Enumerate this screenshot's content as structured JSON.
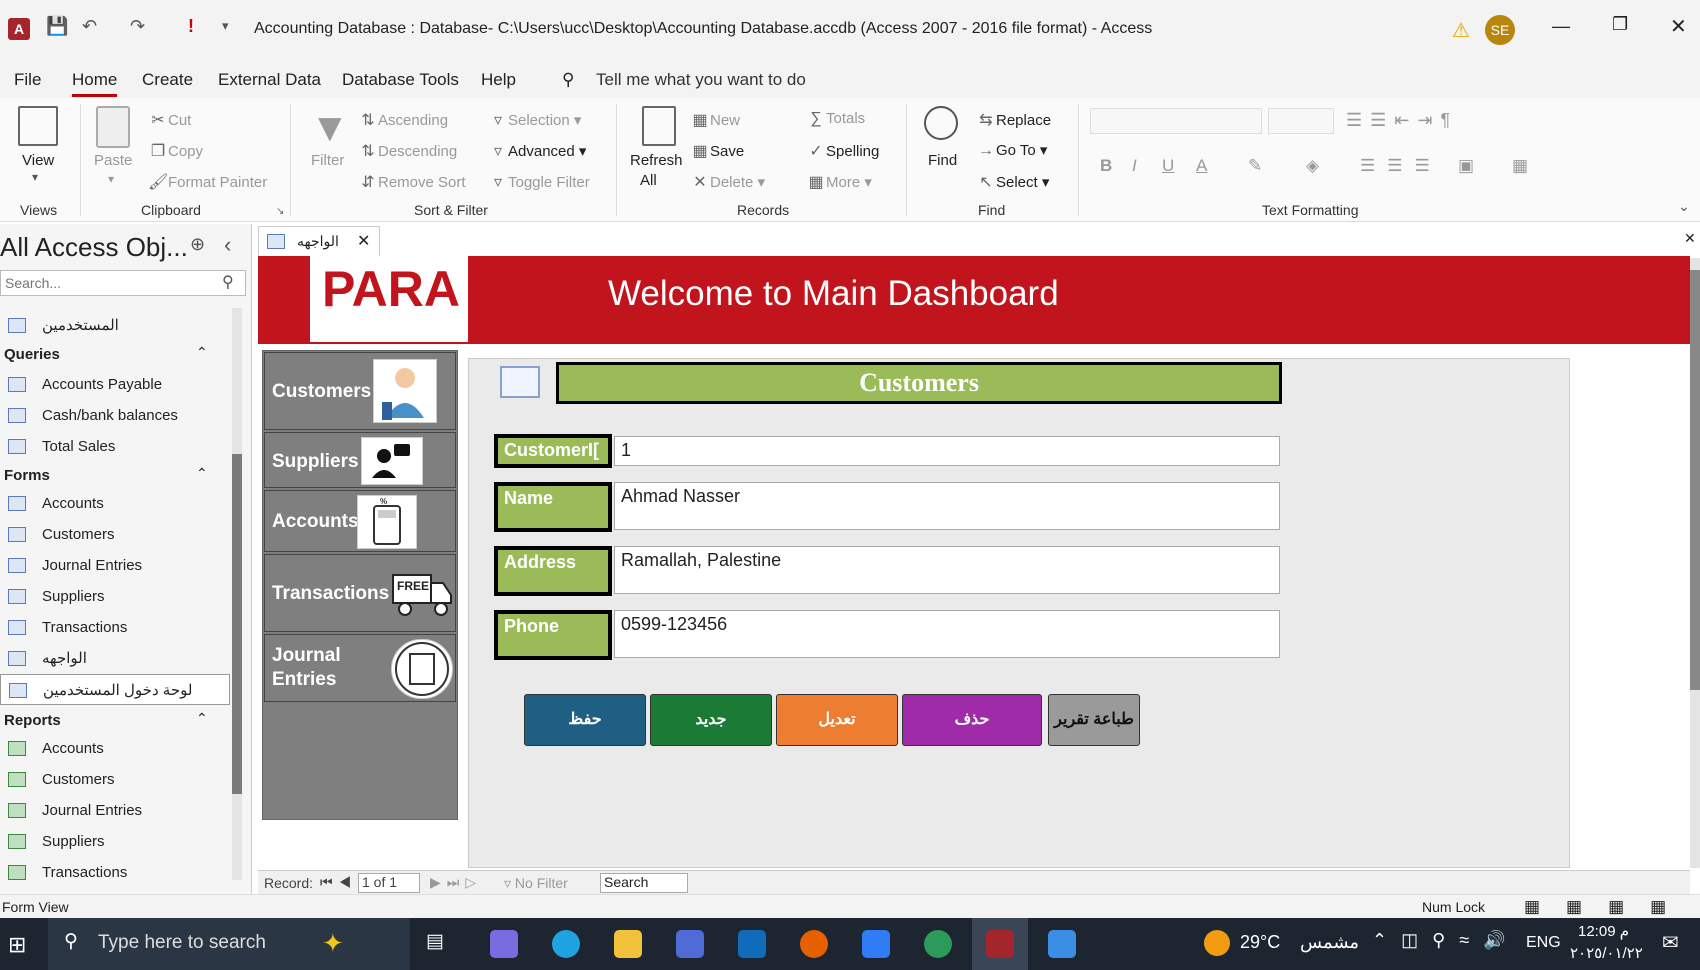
{
  "titlebar": {
    "title": "Accounting Database : Database- C:\\Users\\ucc\\Desktop\\Accounting Database.accdb (Access 2007 - 2016 file format)  -  Access",
    "user_initials": "SE"
  },
  "menu": {
    "file": "File",
    "home": "Home",
    "create": "Create",
    "external_data": "External Data",
    "database_tools": "Database Tools",
    "help": "Help",
    "tell_me": "Tell me what you want to do"
  },
  "ribbon": {
    "views": {
      "view": "View",
      "group": "Views"
    },
    "clipboard": {
      "paste": "Paste",
      "cut": "Cut",
      "copy": "Copy",
      "format_painter": "Format Painter",
      "group": "Clipboard"
    },
    "sort_filter": {
      "filter": "Filter",
      "ascending": "Ascending",
      "descending": "Descending",
      "remove_sort": "Remove Sort",
      "selection": "Selection",
      "advanced": "Advanced",
      "toggle_filter": "Toggle Filter",
      "group": "Sort & Filter"
    },
    "records": {
      "refresh_all": "Refresh",
      "refresh_all2": "All",
      "new": "New",
      "save": "Save",
      "delete": "Delete",
      "totals": "Totals",
      "spelling": "Spelling",
      "more": "More",
      "group": "Records"
    },
    "find": {
      "find": "Find",
      "replace": "Replace",
      "go_to": "Go To",
      "select": "Select",
      "group": "Find"
    },
    "text_formatting": {
      "group": "Text Formatting"
    }
  },
  "nav": {
    "title": "All Access Obj...",
    "search_placeholder": "Search...",
    "top_item": "المستخدمين",
    "queries_header": "Queries",
    "queries": [
      "Accounts Payable",
      "Cash/bank balances",
      "Total Sales"
    ],
    "forms_header": "Forms",
    "forms": [
      "Accounts",
      "Customers",
      "Journal Entries",
      "Suppliers",
      "Transactions",
      "الواجهه",
      "لوحة دخول المستخدمين"
    ],
    "reports_header": "Reports",
    "reports": [
      "Accounts",
      "Customers",
      "Journal Entries",
      "Suppliers",
      "Transactions"
    ]
  },
  "doc": {
    "tab": "الواجهه",
    "logo": "PARA",
    "welcome": "Welcome to Main Dashboard",
    "sidebar": {
      "customers": "Customers",
      "suppliers": "Suppliers",
      "accounts": "Accounts",
      "transactions": "Transactions",
      "journal": "Journal",
      "entries": "Entries",
      "free": "FREE"
    },
    "form": {
      "title": "Customers",
      "fields": [
        {
          "label": "CustomerI[",
          "value": "1"
        },
        {
          "label": "Name",
          "value": "Ahmad Nasser"
        },
        {
          "label": "Address",
          "value": "Ramallah, Palestine"
        },
        {
          "label": "Phone",
          "value": "0599-123456"
        }
      ],
      "buttons": {
        "save": "حفظ",
        "new": "جديد",
        "edit": "تعديل",
        "delete": "حذف",
        "print": "طباعة تقرير"
      }
    }
  },
  "recnav": {
    "record": "Record:",
    "position": "1 of 1",
    "no_filter": "No Filter",
    "search": "Search"
  },
  "status": {
    "view": "Form View",
    "numlock": "Num Lock"
  },
  "taskbar": {
    "search": "Type here to search",
    "temp": "29°C",
    "weather": "مشمس",
    "lang": "ENG",
    "time": "12:09 م",
    "date": "٢٠٢٥/٠١/٢٢"
  },
  "colors": {
    "header": "#c1141c",
    "green": "#9bbb59",
    "save": "#1f5f84",
    "new": "#1a7a36",
    "edit": "#ed7d31",
    "delete": "#a02ba8",
    "print": "#9a9a9a"
  }
}
